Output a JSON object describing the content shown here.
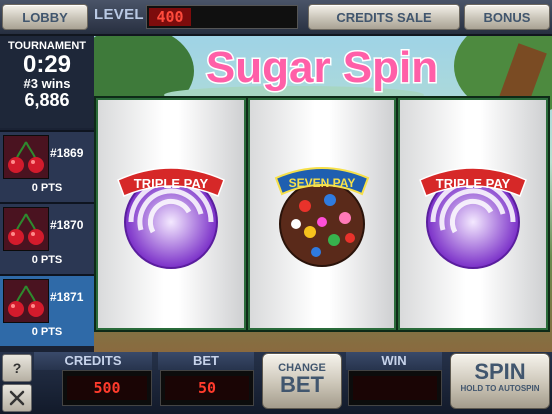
{
  "topbar": {
    "lobby_label": "LOBBY",
    "level_label": "LEVEL",
    "level_value": "400",
    "credits_sale_label": "CREDITS SALE",
    "bonus_label": "BONUS"
  },
  "game": {
    "logo_text": "Sugar Spin"
  },
  "tournament": {
    "title": "TOURNAMENT",
    "time": "0:29",
    "wins": "#3 wins",
    "score": "6,886"
  },
  "slots": [
    {
      "id": "#1869",
      "points": "0 PTS",
      "active": false
    },
    {
      "id": "#1870",
      "points": "0 PTS",
      "active": false
    },
    {
      "id": "#1871",
      "points": "0 PTS",
      "active": true
    }
  ],
  "reels": [
    {
      "symbol": "triple-pay-lollipop",
      "label": "TRIPLE PAY"
    },
    {
      "symbol": "seven-pay-candy-cookie",
      "label": "SEVEN PAY"
    },
    {
      "symbol": "triple-pay-lollipop",
      "label": "TRIPLE PAY"
    }
  ],
  "bottom": {
    "help_label": "?",
    "settings_icon": "wrench-screwdriver-icon",
    "credits_label": "CREDITS",
    "credits_value": "500",
    "bet_label": "BET",
    "bet_value": "50",
    "change_bet_line1": "CHANGE",
    "change_bet_line2": "BET",
    "win_label": "WIN",
    "win_value": "",
    "spin_label": "SPIN",
    "spin_sub": "HOLD TO AUTOSPIN"
  },
  "colors": {
    "lollipop_purple": "#7a2fc8",
    "banner_red": "#d62828",
    "seven_pay_banner": "#1f5fb0",
    "meter_red": "#ff3b2c"
  }
}
